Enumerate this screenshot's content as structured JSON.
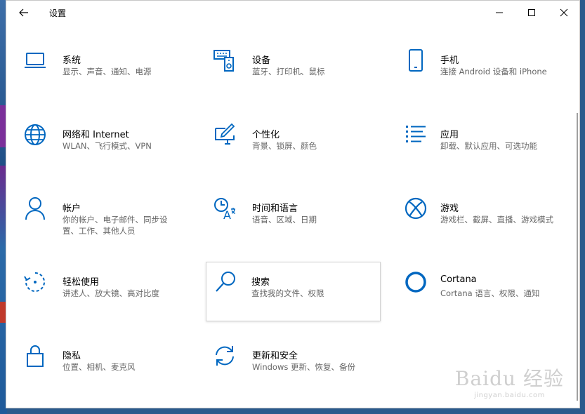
{
  "window": {
    "title": "设置",
    "back_icon": "back-arrow-icon",
    "minimize_icon": "minimize-icon",
    "maximize_icon": "maximize-icon",
    "close_icon": "close-icon"
  },
  "accent_color": "#0067c0",
  "tiles": [
    {
      "id": "system",
      "name": "系统",
      "desc": "显示、声音、通知、电源",
      "icon": "laptop-icon"
    },
    {
      "id": "devices",
      "name": "设备",
      "desc": "蓝牙、打印机、鼠标",
      "icon": "keyboard-speaker-icon"
    },
    {
      "id": "phone",
      "name": "手机",
      "desc": "连接 Android 设备和 iPhone",
      "icon": "phone-icon"
    },
    {
      "id": "network",
      "name": "网络和 Internet",
      "desc": "WLAN、飞行模式、VPN",
      "icon": "globe-icon"
    },
    {
      "id": "personalization",
      "name": "个性化",
      "desc": "背景、锁屏、颜色",
      "icon": "paint-monitor-icon"
    },
    {
      "id": "apps",
      "name": "应用",
      "desc": "卸载、默认应用、可选功能",
      "icon": "apps-list-icon"
    },
    {
      "id": "accounts",
      "name": "帐户",
      "desc": "你的帐户、电子邮件、同步设置、工作、其他人员",
      "icon": "person-icon"
    },
    {
      "id": "time-language",
      "name": "时间和语言",
      "desc": "语音、区域、日期",
      "icon": "clock-language-icon"
    },
    {
      "id": "gaming",
      "name": "游戏",
      "desc": "游戏栏、截屏、直播、游戏模式",
      "icon": "xbox-icon"
    },
    {
      "id": "ease-of-access",
      "name": "轻松使用",
      "desc": "讲述人、放大镜、高对比度",
      "icon": "ease-of-access-icon"
    },
    {
      "id": "search",
      "name": "搜索",
      "desc": "查找我的文件、权限",
      "icon": "search-icon"
    },
    {
      "id": "cortana",
      "name": "Cortana",
      "desc": "Cortana 语言、权限、通知",
      "icon": "cortana-ring-icon"
    },
    {
      "id": "privacy",
      "name": "隐私",
      "desc": "位置、相机、麦克风",
      "icon": "lock-icon"
    },
    {
      "id": "update-security",
      "name": "更新和安全",
      "desc": "Windows 更新、恢复、备份",
      "icon": "sync-arrows-icon"
    }
  ],
  "watermark": {
    "top": "Baidu 经验",
    "bottom": "jingyan.baidu.com"
  }
}
